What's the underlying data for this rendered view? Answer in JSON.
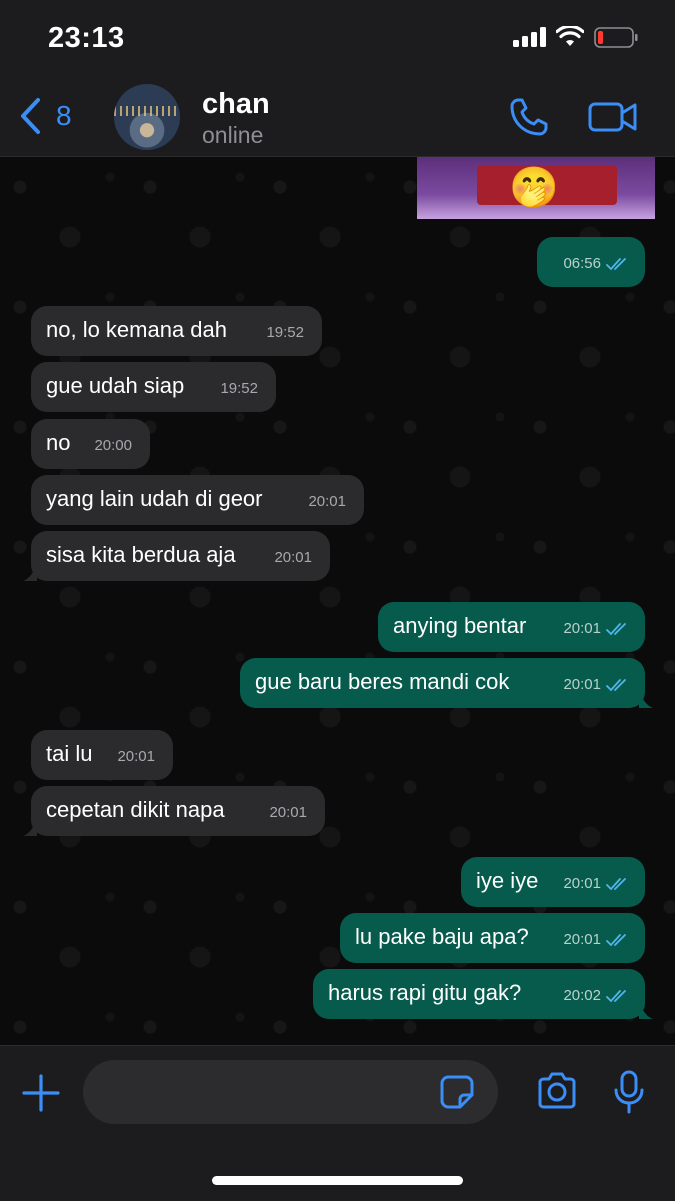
{
  "status_bar": {
    "time": "23:13"
  },
  "header": {
    "back_count": "8",
    "contact_name": "chan",
    "presence": "online"
  },
  "messages": [
    {
      "dir": "out",
      "text": "",
      "time": "06:56",
      "read": true
    },
    {
      "dir": "in",
      "text": "no, lo kemana dah",
      "time": "19:52"
    },
    {
      "dir": "in",
      "text": "gue udah siap",
      "time": "19:52"
    },
    {
      "dir": "in",
      "text": "no",
      "time": "20:00"
    },
    {
      "dir": "in",
      "text": "yang lain udah di geor",
      "time": "20:01"
    },
    {
      "dir": "in",
      "text": "sisa kita berdua aja",
      "time": "20:01"
    },
    {
      "dir": "out",
      "text": "anying bentar",
      "time": "20:01",
      "read": true
    },
    {
      "dir": "out",
      "text": "gue baru beres mandi cok",
      "time": "20:01",
      "read": true
    },
    {
      "dir": "in",
      "text": "tai lu",
      "time": "20:01"
    },
    {
      "dir": "in",
      "text": "cepetan dikit napa",
      "time": "20:01"
    },
    {
      "dir": "out",
      "text": "iye iye",
      "time": "20:01",
      "read": true
    },
    {
      "dir": "out",
      "text": "lu pake baju apa?",
      "time": "20:01",
      "read": true
    },
    {
      "dir": "out",
      "text": "harus rapi gitu gak?",
      "time": "20:02",
      "read": true
    }
  ],
  "input": {
    "placeholder": ""
  },
  "icons": {
    "back": "chevron-left-icon",
    "call": "phone-icon",
    "video": "video-camera-icon",
    "plus": "plus-icon",
    "sticker": "sticker-icon",
    "camera": "camera-icon",
    "mic": "microphone-icon",
    "ticks": "double-check-icon"
  },
  "colors": {
    "accent": "#3a8ef6",
    "incoming_bubble": "#2b2b2d",
    "outgoing_bubble": "#075b4c",
    "read_ticks": "#4fb6ec"
  }
}
